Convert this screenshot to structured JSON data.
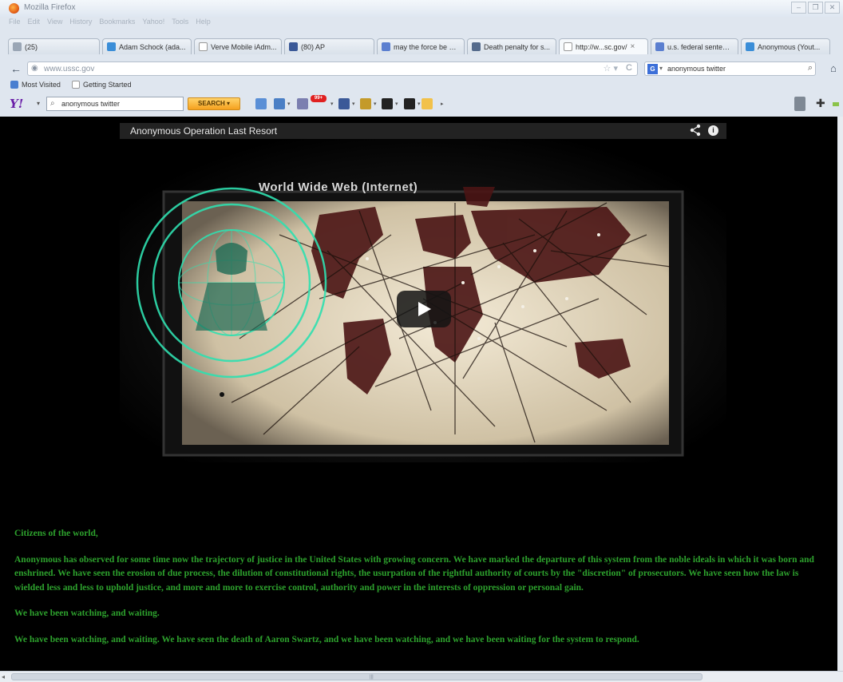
{
  "window": {
    "title": "Mozilla Firefox",
    "buttons": [
      "–",
      "❐",
      "✕"
    ]
  },
  "menu": [
    "File",
    "Edit",
    "View",
    "History",
    "Bookmarks",
    "Yahoo!",
    "Tools",
    "Help"
  ],
  "tabs": [
    {
      "label": "(25)",
      "color": "#9aa6b5",
      "active": false
    },
    {
      "label": "Adam Schock (ada...",
      "color": "#3b8ed8",
      "active": false
    },
    {
      "label": "Verve Mobile iAdm...",
      "color": "#ffffff",
      "active": false
    },
    {
      "label": "(80) AP",
      "color": "#3b5998",
      "active": false
    },
    {
      "label": "may the force be w...",
      "color": "#5b7fd0",
      "active": false
    },
    {
      "label": "Death penalty for s...",
      "color": "#556b8c",
      "active": false
    },
    {
      "label": "http://w...sc.gov/",
      "color": "#ffffff",
      "active": true
    },
    {
      "label": "u.s. federal sentenc...",
      "color": "#5b7fd0",
      "active": false
    },
    {
      "label": "Anonymous (Yout...",
      "color": "#3b8ed8",
      "active": false
    }
  ],
  "navbar": {
    "url": "www.ussc.gov",
    "search_value": "anonymous twitter",
    "search_engine": "G"
  },
  "bookmarks": [
    "Most Visited",
    "Getting Started"
  ],
  "yahoo_toolbar": {
    "search_value": "anonymous twitter",
    "search_button": "SEARCH",
    "mail_badge": "99+"
  },
  "video": {
    "title": "Anonymous Operation Last Resort",
    "heading": "World Wide Web (Internet)",
    "info": "i"
  },
  "manifesto": {
    "p1": "Citizens of the world,",
    "p2": "Anonymous has observed for some time now the trajectory of justice in the United States with growing concern. We have marked the departure of this system from the noble ideals in which it was born and enshrined. We have seen the erosion of due process, the dilution of constitutional rights, the usurpation of the rightful authority of courts by the \"discretion\" of prosecutors. We have seen how the law is wielded less and less to uphold justice, and more and more to exercise control, authority and power in the interests of oppression or personal gain.",
    "p3": "We have been watching, and waiting.",
    "p4": "We have been watching, and waiting. We have seen the death of Aaron Swartz, and we have been watching, and we have been waiting for the system to respond."
  },
  "colors": {
    "manifesto": "#2da12d",
    "page_bg": "#000000",
    "chrome_bg": "#dfe6ef"
  }
}
